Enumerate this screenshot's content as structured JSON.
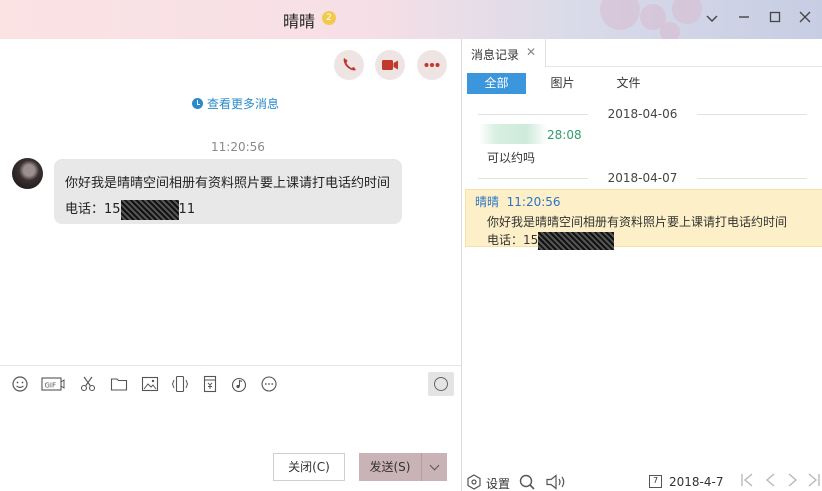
{
  "window": {
    "title": "晴晴",
    "badge": "2"
  },
  "chat": {
    "more_messages": "查看更多消息",
    "timestamp": "11:20:56",
    "bubble_line1": "你好我是晴晴空间相册有资料照片要上课请打电话约时间",
    "bubble_phone_prefix": "电话：15",
    "bubble_phone_suffix": "11"
  },
  "buttons": {
    "close": "关闭(C)",
    "send": "发送(S)"
  },
  "history": {
    "tab_title": "消息记录",
    "tab_close": "✕",
    "filters": [
      "全部",
      "图片",
      "文件"
    ],
    "date1": "2018-04-06",
    "msg1_time": "28:08",
    "msg1_text": "可以约吗",
    "date2": "2018-04-07",
    "msg2_sender": "晴晴",
    "msg2_time": "11:20:56",
    "msg2_line1": "你好我是晴晴空间相册有资料照片要上课请打电话约时间",
    "msg2_phone_prefix": "电话：15",
    "settings": "设置",
    "current_date": "2018-4-7",
    "calendar_day": "7"
  },
  "icons": {
    "window_controls": [
      "chevron-down-icon",
      "minimize-icon",
      "maximize-icon",
      "close-icon"
    ],
    "call_buttons": [
      "phone-icon",
      "video-icon",
      "more-icon"
    ],
    "toolbar": [
      "emoji-icon",
      "gif-icon",
      "scissors-icon",
      "folder-icon",
      "image-icon",
      "shake-icon",
      "red-packet-icon",
      "music-icon",
      "more-circle-icon",
      "clock-icon"
    ]
  },
  "colors": {
    "accent": "#3c96dc",
    "call_icon": "#c0392b",
    "send_button": "#c9b3b7",
    "highlight": "#fdf0c8"
  }
}
